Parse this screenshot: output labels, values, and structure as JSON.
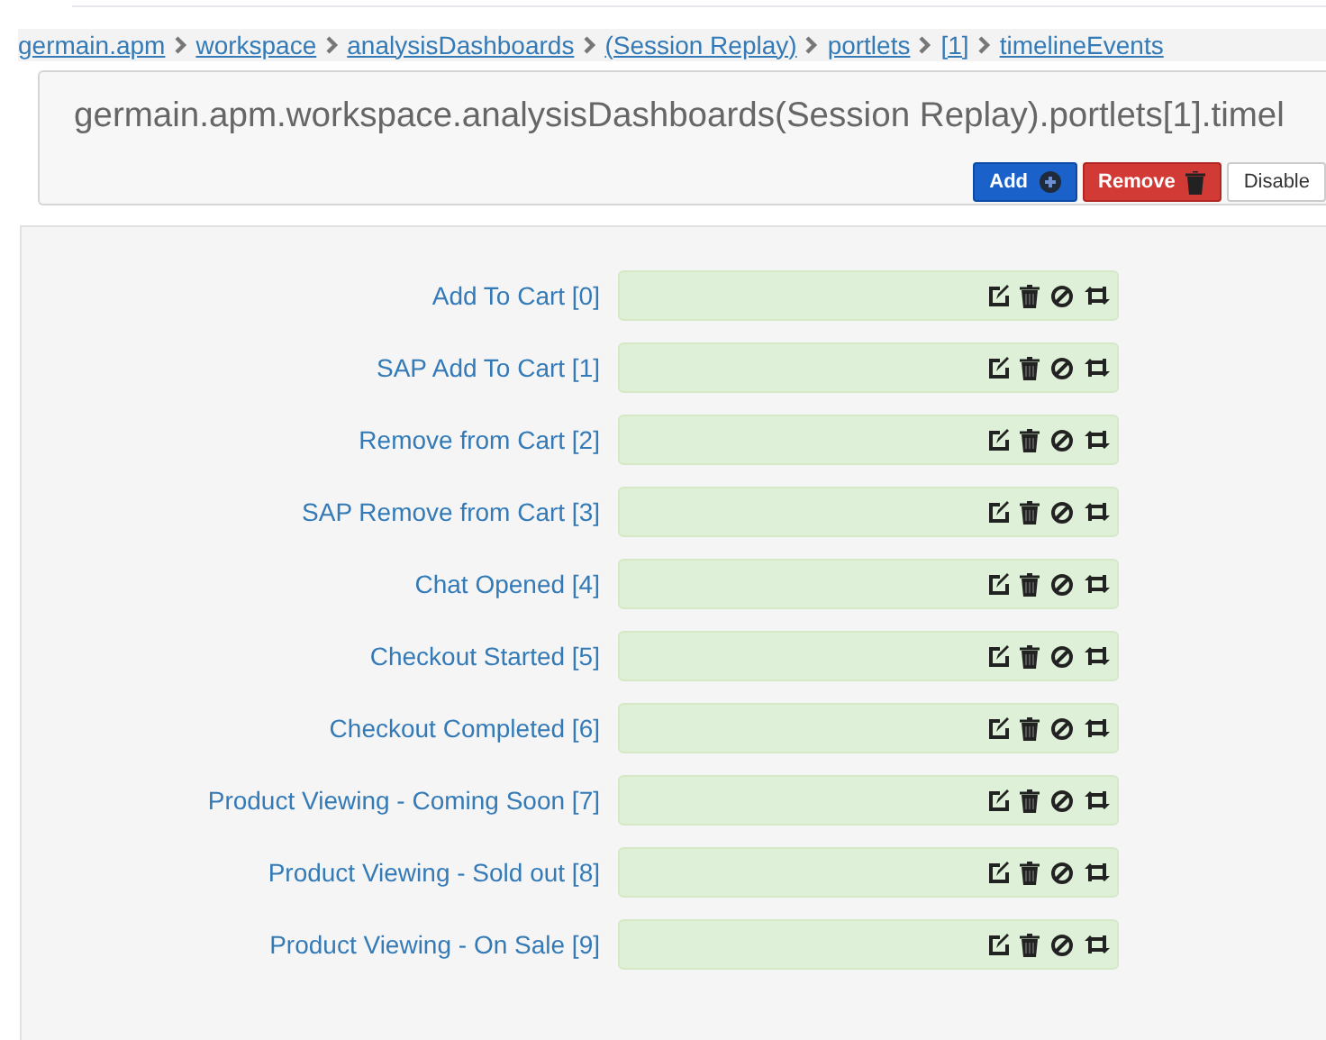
{
  "breadcrumb": [
    "germain.apm",
    "workspace",
    "analysisDashboards",
    "(Session Replay)",
    "portlets",
    "[1]",
    "timelineEvents"
  ],
  "header": {
    "title": "germain.apm.workspace.analysisDashboards(Session Replay).portlets[1].timel",
    "buttons": [
      {
        "kind": "add",
        "label": "Add"
      },
      {
        "kind": "remove",
        "label": "Remove"
      },
      {
        "kind": "disable",
        "label": "Disable"
      }
    ]
  },
  "items": [
    {
      "label": "Add To Cart [0]"
    },
    {
      "label": "SAP Add To Cart [1]"
    },
    {
      "label": "Remove from Cart [2]"
    },
    {
      "label": "SAP Remove from Cart [3]"
    },
    {
      "label": "Chat Opened [4]"
    },
    {
      "label": "Checkout Started [5]"
    },
    {
      "label": "Checkout Completed [6]"
    },
    {
      "label": "Product Viewing - Coming Soon [7]"
    },
    {
      "label": "Product Viewing - Sold out [8]"
    },
    {
      "label": "Product Viewing - On Sale [9]"
    }
  ]
}
